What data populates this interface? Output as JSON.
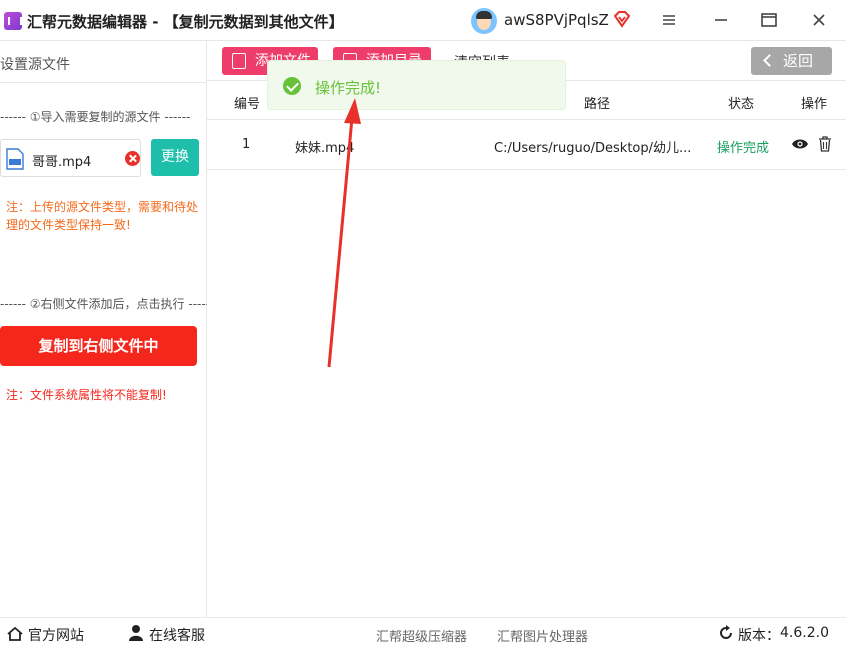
{
  "window": {
    "title": "汇帮元数据编辑器 - 【复制元数据到其他文件】",
    "username": "awS8PVjPqlsZ",
    "icons": [
      "app-logo-icon",
      "avatar",
      "vip-diamond-icon",
      "menu-icon",
      "minimize-icon",
      "maximize-icon",
      "close-icon"
    ]
  },
  "left": {
    "title": "设置源文件",
    "step1": "------ ①导入需要复制的源文件 ------",
    "file_name": "哥哥.mp4",
    "replace_label": "更换",
    "note1": "注：上传的源文件类型，需要和待处理的文件类型保持一致!",
    "step2": "------ ②右侧文件添加后，点击执行 ------",
    "copy_label": "复制到右侧文件中",
    "note2": "注：文件系统属性将不能复制!"
  },
  "toolbar": {
    "add_file": "添加文件",
    "add_dir": "添加目录",
    "clear": "清空列表",
    "back": "返回"
  },
  "table": {
    "headers": {
      "index": "编号",
      "path": "路径",
      "status": "状态",
      "action": "操作"
    },
    "rows": [
      {
        "index": "1",
        "name": "妹妹.mp4",
        "path": "C:/Users/ruguo/Desktop/幼儿...",
        "status": "操作完成"
      }
    ]
  },
  "toast": {
    "message": "操作完成!"
  },
  "footer": {
    "official_site": "官方网站",
    "online_service": "在线客服",
    "link1": "汇帮超级压缩器",
    "link2": "汇帮图片处理器",
    "version_label": "版本：",
    "version": "4.6.2.0"
  },
  "colors": {
    "accent_pink": "#ef3d6b",
    "accent_red": "#f5271c",
    "accent_teal": "#1dbfaa",
    "success_green": "#16a05d",
    "toast_green": "#67c23a"
  }
}
